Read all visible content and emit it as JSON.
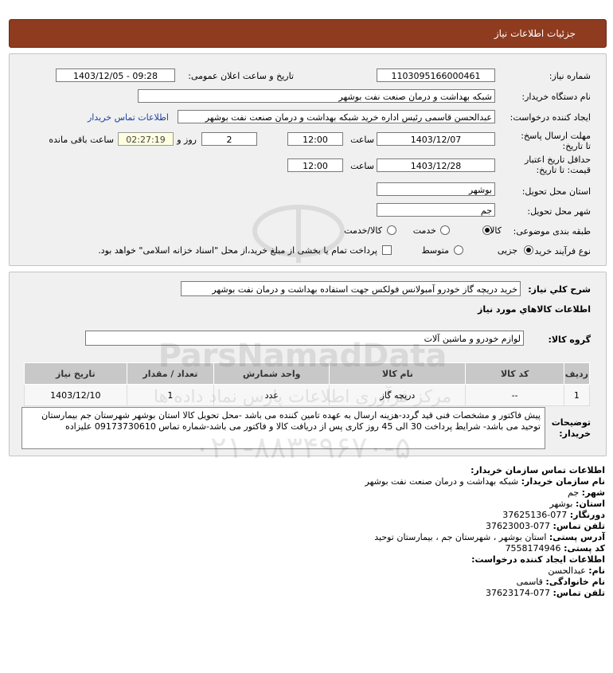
{
  "title": "جزئیات اطلاعات نیاز",
  "labels": {
    "need_number": "شماره نیاز:",
    "announce_datetime": "تاریخ و ساعت اعلان عمومی:",
    "buyer_org": "نام دستگاه خریدار:",
    "requester": "ایجاد کننده درخواست:",
    "buyer_contact_link": "اطلاعات تماس خریدار",
    "deadline_send": "مهلت ارسال پاسخ: تا تاریخ:",
    "time": "ساعت",
    "day_and": "روز و",
    "remaining": "ساعت باقی مانده",
    "price_validity": "حداقل تاریخ اعتبار قیمت: تا تاریخ:",
    "province": "استان محل تحویل:",
    "city": "شهر محل تحویل:",
    "category": "طبقه بندی موضوعی:",
    "process": "نوع فرآیند خرید :",
    "summary": "شرح کلي نياز:",
    "goods_info": "اطلاعات کالاهاي مورد نياز",
    "goods_group": "گروه کالا:",
    "buyer_notes": "توضیحات خریدار:"
  },
  "values": {
    "need_number": "1103095166000461",
    "announce_datetime": "1403/12/05 - 09:28",
    "buyer_org": "شبکه بهداشت و درمان صنعت نفت بوشهر",
    "requester": "عبدالحسن قاسمی رئیس اداره خرید  شبکه بهداشت و درمان صنعت نفت بوشهر",
    "deadline_date": "1403/12/07",
    "deadline_time": "12:00",
    "days": "2",
    "countdown": "02:27:19",
    "validity_date": "1403/12/28",
    "validity_time": "12:00",
    "province": "بوشهر",
    "city": "جم",
    "summary": "خرید دریچه گاز خودرو آمبولانس فولکس جهت استفاده بهداشت و درمان نفت بوشهر",
    "goods_group": "لوازم خودرو و ماشین آلات",
    "buyer_notes": "پیش فاکتور و مشخصات فنی قید گردد-هزینه ارسال به عهده تامین کننده می باشد -محل تحویل کالا استان بوشهر شهرستان جم بیمارستان توحید می باشد- شرایط پرداخت 30 الی 45 روز کاری پس از دریافت کالا و فاکتور می باشد-شماره تماس 09173730610 علیزاده"
  },
  "category_options": [
    {
      "label": "کالا",
      "selected": true
    },
    {
      "label": "خدمت",
      "selected": false
    },
    {
      "label": "کالا/خدمت",
      "selected": false
    }
  ],
  "process_options": [
    {
      "label": "جزیی",
      "selected": true
    },
    {
      "label": "متوسط",
      "selected": false
    }
  ],
  "payment_note": "پرداخت تمام یا بخشی از مبلغ خرید،از محل \"اسناد خزانه اسلامی\" خواهد بود.",
  "table": {
    "headers": [
      "ردیف",
      "کد کالا",
      "نام کالا",
      "واحد شمارش",
      "تعداد / مقدار",
      "تاریخ نیاز"
    ],
    "rows": [
      [
        "1",
        "--",
        "دریچه گاز",
        "عدد",
        "1",
        "1403/12/10"
      ]
    ]
  },
  "contact": {
    "heading": "اطلاعات تماس سازمان خریدار:",
    "org_label": "نام سازمان خریدار:",
    "org_value": "شبکه بهداشت و درمان صنعت نفت بوشهر",
    "city_label": "شهر:",
    "city_value": "جم",
    "province_label": "استان:",
    "province_value": "بوشهر",
    "fax_label": "دورنگار:",
    "fax_value": "077-37625136",
    "phone_label": "تلفن تماس:",
    "phone_value": "077-37623003",
    "address_label": "آدرس پستی:",
    "address_value": "استان بوشهر ، شهرستان جم ، بیمارستان توحید",
    "postal_label": "کد پستی:",
    "postal_value": "7558174946",
    "creator_heading": "اطلاعات ایجاد کننده درخواست:",
    "name_label": "نام:",
    "name_value": "عبدالحسن",
    "family_label": "نام خانوادگی:",
    "family_value": "قاسمی",
    "creator_phone_label": "تلفن تماس:",
    "creator_phone_value": "077-37623174"
  },
  "watermark": {
    "site": "ParsNamadData",
    "fa": "مرکز فرآوری اطلاعات پارس نماد داده ها",
    "phone": "۰۲۱-۸۸۳۴۹۶۷۰-۵"
  },
  "colors": {
    "title_bar": "#8e3b1f",
    "link": "#1a3fa0",
    "table_header": "#c8c8c8"
  }
}
